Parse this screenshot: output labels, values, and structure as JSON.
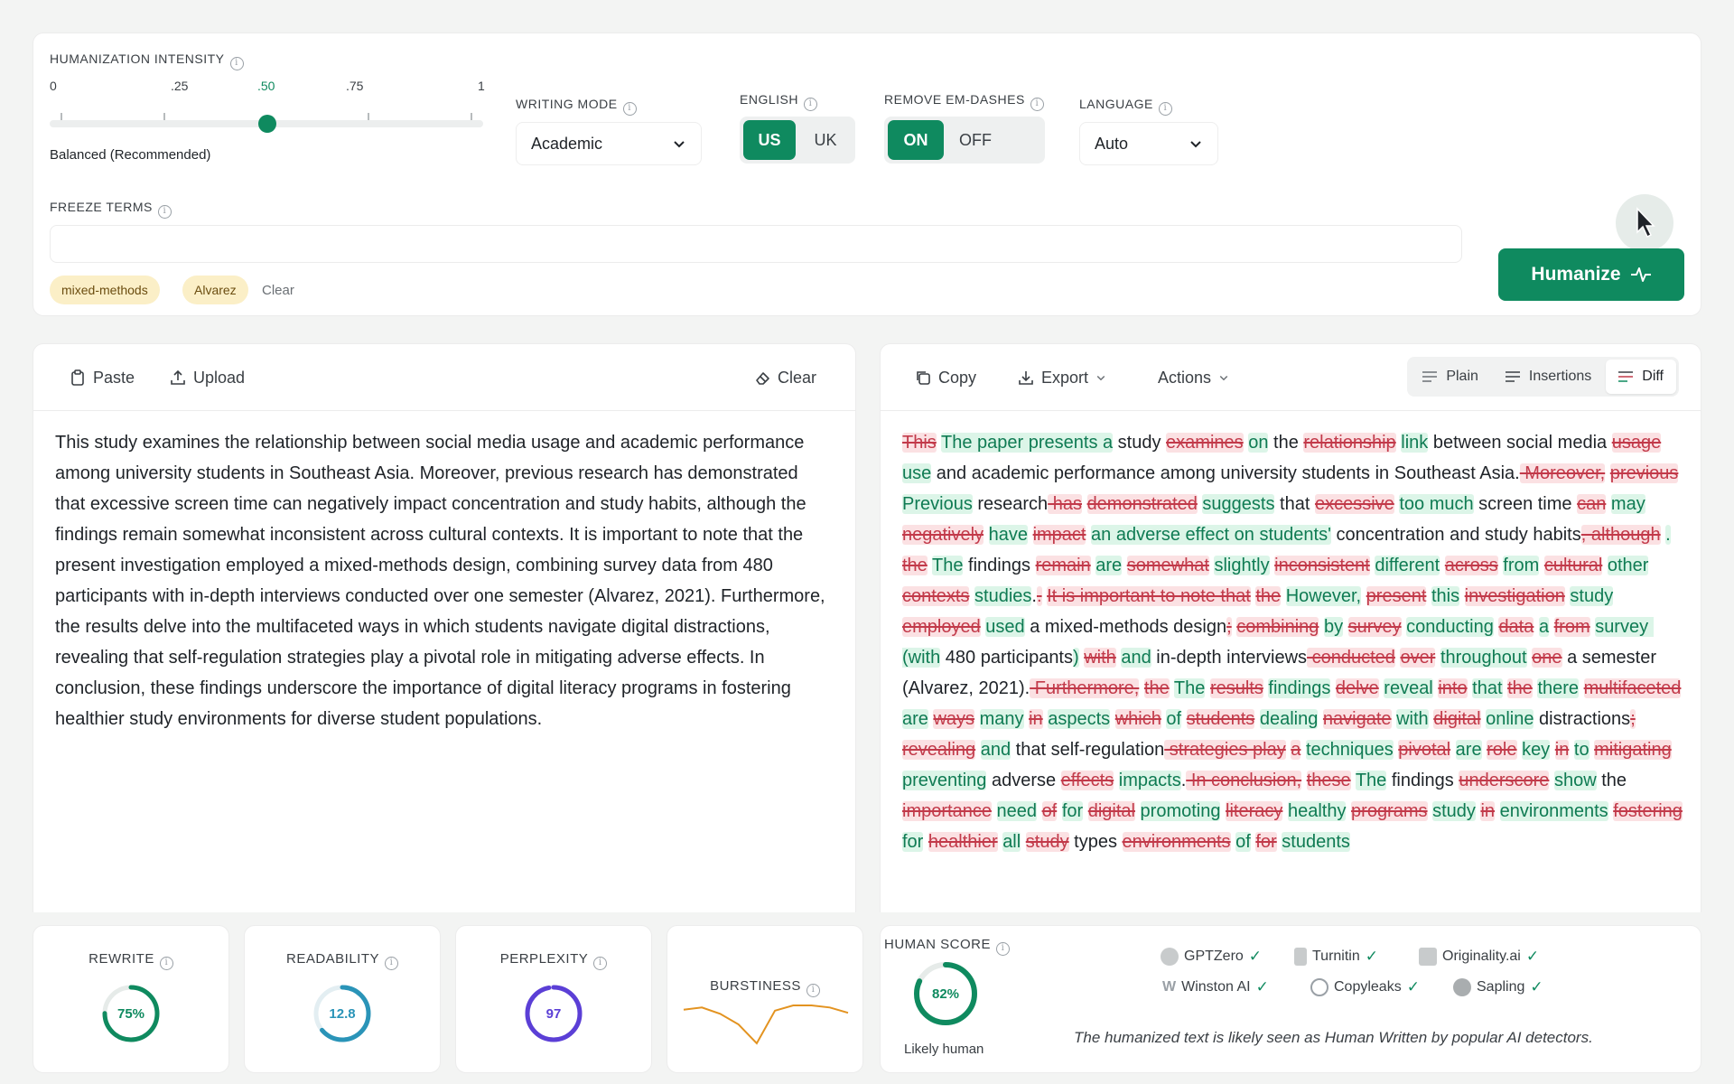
{
  "settings": {
    "intensity": {
      "label": "HUMANIZATION INTENSITY",
      "ticks": [
        "0",
        ".25",
        ".50",
        ".75",
        "1"
      ],
      "active_tick": ".50",
      "value": 0.5,
      "caption": "Balanced (Recommended)"
    },
    "writing_mode": {
      "label": "WRITING MODE",
      "value": "Academic"
    },
    "english": {
      "label": "ENGLISH",
      "options": [
        "US",
        "UK"
      ],
      "selected": "US"
    },
    "em_dashes": {
      "label": "REMOVE EM-DASHES",
      "options": [
        "ON",
        "OFF"
      ],
      "selected": "ON"
    },
    "language": {
      "label": "LANGUAGE",
      "value": "Auto"
    },
    "freeze_terms": {
      "label": "FREEZE TERMS",
      "value": "",
      "chips": [
        "mixed-methods",
        "Alvarez"
      ],
      "clear_label": "Clear"
    },
    "humanize_button": "Humanize"
  },
  "input_panel": {
    "paste_label": "Paste",
    "upload_label": "Upload",
    "clear_label": "Clear",
    "text": "This study examines the relationship between social media usage and academic performance among university students in Southeast Asia. Moreover, previous research has demonstrated that excessive screen time can negatively impact concentration and study habits, although the findings remain somewhat inconsistent across cultural contexts. It is important to note that the present investigation employed a mixed-methods design, combining survey data from 480 participants with in-depth interviews conducted over one semester (Alvarez, 2021). Furthermore, the results delve into the multifaceted ways in which students navigate digital distractions, revealing that self-regulation strategies play a pivotal role in mitigating adverse effects. In conclusion, these findings underscore the importance of digital literacy programs in fostering healthier study environments for diverse student populations."
  },
  "output_panel": {
    "copy_label": "Copy",
    "export_label": "Export",
    "actions_label": "Actions",
    "views": [
      "Plain",
      "Insertions",
      "Diff"
    ],
    "selected_view": "Diff",
    "diff": [
      [
        "d",
        "This"
      ],
      [
        " ",
        " "
      ],
      [
        "i",
        "The paper presents a"
      ],
      [
        " ",
        " study "
      ],
      [
        "d",
        "examines"
      ],
      [
        " ",
        " "
      ],
      [
        "i",
        "on"
      ],
      [
        " ",
        " the "
      ],
      [
        "d",
        "relationship"
      ],
      [
        " ",
        " "
      ],
      [
        "i",
        "link"
      ],
      [
        " ",
        " between social media "
      ],
      [
        "d",
        "usage"
      ],
      [
        " ",
        " "
      ],
      [
        "i",
        "use"
      ],
      [
        " ",
        " and academic performance among university students in Southeast Asia."
      ],
      [
        "d",
        " Moreover,"
      ],
      [
        " ",
        " "
      ],
      [
        "d",
        "previous"
      ],
      [
        " ",
        " "
      ],
      [
        "i",
        "Previous"
      ],
      [
        " ",
        " research"
      ],
      [
        "d",
        " has"
      ],
      [
        " ",
        " "
      ],
      [
        "d",
        "demonstrated"
      ],
      [
        " ",
        " "
      ],
      [
        "i",
        "suggests"
      ],
      [
        " ",
        " that "
      ],
      [
        "d",
        "excessive"
      ],
      [
        " ",
        " "
      ],
      [
        "i",
        "too much"
      ],
      [
        " ",
        " screen time "
      ],
      [
        "d",
        "can"
      ],
      [
        " ",
        " "
      ],
      [
        "i",
        "may"
      ],
      [
        " ",
        " "
      ],
      [
        "d",
        "negatively"
      ],
      [
        " ",
        " "
      ],
      [
        "i",
        "have"
      ],
      [
        " ",
        " "
      ],
      [
        "d",
        "impact"
      ],
      [
        " ",
        " "
      ],
      [
        "i",
        "an adverse effect on students'"
      ],
      [
        " ",
        " concentration and study habits"
      ],
      [
        "d",
        ", although"
      ],
      [
        " ",
        " "
      ],
      [
        "i",
        "."
      ],
      [
        " ",
        " "
      ],
      [
        "d",
        "the"
      ],
      [
        " ",
        " "
      ],
      [
        "i",
        "The"
      ],
      [
        " ",
        " findings "
      ],
      [
        "d",
        "remain"
      ],
      [
        " ",
        " "
      ],
      [
        "i",
        "are"
      ],
      [
        " ",
        " "
      ],
      [
        "d",
        "somewhat"
      ],
      [
        " ",
        " "
      ],
      [
        "i",
        "slightly"
      ],
      [
        " ",
        " "
      ],
      [
        "d",
        "inconsistent"
      ],
      [
        " ",
        " "
      ],
      [
        "i",
        "different"
      ],
      [
        " ",
        " "
      ],
      [
        "d",
        "across"
      ],
      [
        " ",
        " "
      ],
      [
        "i",
        "from"
      ],
      [
        " ",
        " "
      ],
      [
        "d",
        "cultural"
      ],
      [
        " ",
        " "
      ],
      [
        "i",
        "other"
      ],
      [
        " ",
        " "
      ],
      [
        "d",
        "contexts"
      ],
      [
        " ",
        " "
      ],
      [
        "i",
        "studies"
      ],
      [
        " ",
        "."
      ],
      [
        "d",
        "."
      ],
      [
        " ",
        " "
      ],
      [
        "d",
        "It is important to note that"
      ],
      [
        " ",
        " "
      ],
      [
        "d",
        "the"
      ],
      [
        " ",
        " "
      ],
      [
        "i",
        "However,"
      ],
      [
        " ",
        " "
      ],
      [
        "d",
        "present"
      ],
      [
        " ",
        " "
      ],
      [
        "i",
        "this"
      ],
      [
        " ",
        " "
      ],
      [
        "d",
        "investigation"
      ],
      [
        " ",
        " "
      ],
      [
        "i",
        "study"
      ],
      [
        " ",
        " "
      ],
      [
        "d",
        "employed"
      ],
      [
        " ",
        " "
      ],
      [
        "i",
        "used"
      ],
      [
        " ",
        " a mixed-methods design"
      ],
      [
        "d",
        ";"
      ],
      [
        " ",
        " "
      ],
      [
        "d",
        "combining"
      ],
      [
        " ",
        " "
      ],
      [
        "i",
        "by"
      ],
      [
        " ",
        " "
      ],
      [
        "d",
        "survey"
      ],
      [
        " ",
        " "
      ],
      [
        "i",
        "conducting"
      ],
      [
        " ",
        " "
      ],
      [
        "d",
        "data"
      ],
      [
        " ",
        " "
      ],
      [
        "i",
        "a"
      ],
      [
        " ",
        " "
      ],
      [
        "d",
        "from"
      ],
      [
        " ",
        " "
      ],
      [
        "i",
        "survey (with"
      ],
      [
        " ",
        " 480 participants"
      ],
      [
        "i",
        ")"
      ],
      [
        " ",
        " "
      ],
      [
        "d",
        "with"
      ],
      [
        " ",
        " "
      ],
      [
        "i",
        "and"
      ],
      [
        " ",
        " in-depth interviews"
      ],
      [
        "d",
        " conducted"
      ],
      [
        " ",
        " "
      ],
      [
        "d",
        "over"
      ],
      [
        " ",
        " "
      ],
      [
        "i",
        "throughout"
      ],
      [
        " ",
        " "
      ],
      [
        "d",
        "one"
      ],
      [
        " ",
        " a semester (Alvarez, 2021)."
      ],
      [
        "d",
        " Furthermore,"
      ],
      [
        " ",
        " "
      ],
      [
        "d",
        "the"
      ],
      [
        " ",
        " "
      ],
      [
        "i",
        "The"
      ],
      [
        " ",
        " "
      ],
      [
        "d",
        "results"
      ],
      [
        " ",
        " "
      ],
      [
        "i",
        "findings"
      ],
      [
        " ",
        " "
      ],
      [
        "d",
        "delve"
      ],
      [
        " ",
        " "
      ],
      [
        "i",
        "reveal"
      ],
      [
        " ",
        " "
      ],
      [
        "d",
        "into"
      ],
      [
        " ",
        " "
      ],
      [
        "i",
        "that"
      ],
      [
        " ",
        " "
      ],
      [
        "d",
        "the"
      ],
      [
        " ",
        " "
      ],
      [
        "i",
        "there"
      ],
      [
        " ",
        " "
      ],
      [
        "d",
        "multifaceted"
      ],
      [
        " ",
        " "
      ],
      [
        "i",
        "are"
      ],
      [
        " ",
        " "
      ],
      [
        "d",
        "ways"
      ],
      [
        " ",
        " "
      ],
      [
        "i",
        "many"
      ],
      [
        " ",
        " "
      ],
      [
        "d",
        "in"
      ],
      [
        " ",
        " "
      ],
      [
        "i",
        "aspects"
      ],
      [
        " ",
        " "
      ],
      [
        "d",
        "which"
      ],
      [
        " ",
        " "
      ],
      [
        "i",
        "of"
      ],
      [
        " ",
        " "
      ],
      [
        "d",
        "students"
      ],
      [
        " ",
        " "
      ],
      [
        "i",
        "dealing"
      ],
      [
        " ",
        " "
      ],
      [
        "d",
        "navigate"
      ],
      [
        " ",
        " "
      ],
      [
        "i",
        "with"
      ],
      [
        " ",
        " "
      ],
      [
        "d",
        "digital"
      ],
      [
        " ",
        " "
      ],
      [
        "i",
        "online"
      ],
      [
        " ",
        " distractions"
      ],
      [
        "d",
        ";"
      ],
      [
        " ",
        " "
      ],
      [
        "d",
        "revealing"
      ],
      [
        " ",
        " "
      ],
      [
        "i",
        "and"
      ],
      [
        " ",
        " that self-regulation"
      ],
      [
        "d",
        " strategies play"
      ],
      [
        " ",
        " "
      ],
      [
        "d",
        "a"
      ],
      [
        " ",
        " "
      ],
      [
        "i",
        "techniques"
      ],
      [
        " ",
        " "
      ],
      [
        "d",
        "pivotal"
      ],
      [
        " ",
        " "
      ],
      [
        "i",
        "are"
      ],
      [
        " ",
        " "
      ],
      [
        "d",
        "role"
      ],
      [
        " ",
        " "
      ],
      [
        "i",
        "key"
      ],
      [
        " ",
        " "
      ],
      [
        "d",
        "in"
      ],
      [
        " ",
        " "
      ],
      [
        "i",
        "to"
      ],
      [
        " ",
        " "
      ],
      [
        "d",
        "mitigating"
      ],
      [
        " ",
        " "
      ],
      [
        "i",
        "preventing"
      ],
      [
        " ",
        " adverse "
      ],
      [
        "d",
        "effects"
      ],
      [
        " ",
        " "
      ],
      [
        "i",
        "impacts"
      ],
      [
        " ",
        "."
      ],
      [
        "d",
        " In conclusion,"
      ],
      [
        " ",
        " "
      ],
      [
        "d",
        "these"
      ],
      [
        " ",
        " "
      ],
      [
        "i",
        "The"
      ],
      [
        " ",
        " findings "
      ],
      [
        "d",
        "underscore"
      ],
      [
        " ",
        " "
      ],
      [
        "i",
        "show"
      ],
      [
        " ",
        " the "
      ],
      [
        "d",
        "importance"
      ],
      [
        " ",
        " "
      ],
      [
        "i",
        "need"
      ],
      [
        " ",
        " "
      ],
      [
        "d",
        "of"
      ],
      [
        " ",
        " "
      ],
      [
        "i",
        "for"
      ],
      [
        " ",
        " "
      ],
      [
        "d",
        "digital"
      ],
      [
        " ",
        " "
      ],
      [
        "i",
        "promoting"
      ],
      [
        " ",
        " "
      ],
      [
        "d",
        "literacy"
      ],
      [
        " ",
        " "
      ],
      [
        "i",
        "healthy"
      ],
      [
        " ",
        " "
      ],
      [
        "d",
        "programs"
      ],
      [
        " ",
        " "
      ],
      [
        "i",
        "study"
      ],
      [
        " ",
        " "
      ],
      [
        "d",
        "in"
      ],
      [
        " ",
        " "
      ],
      [
        "i",
        "environments"
      ],
      [
        " ",
        " "
      ],
      [
        "d",
        "fostering"
      ],
      [
        " ",
        " "
      ],
      [
        "i",
        "for"
      ],
      [
        " ",
        " "
      ],
      [
        "d",
        "healthier"
      ],
      [
        " ",
        " "
      ],
      [
        "i",
        "all"
      ],
      [
        " ",
        " "
      ],
      [
        "d",
        "study"
      ],
      [
        " ",
        " types "
      ],
      [
        "d",
        "environments"
      ],
      [
        " ",
        " "
      ],
      [
        "i",
        "of"
      ],
      [
        " ",
        " "
      ],
      [
        "d",
        "for"
      ],
      [
        " ",
        " "
      ],
      [
        "i",
        "students"
      ]
    ]
  },
  "metrics": {
    "rewrite": {
      "label": "REWRITE",
      "value": "75%",
      "fraction": 0.75,
      "color": "#0f8a5f"
    },
    "readability": {
      "label": "READABILITY",
      "value": "12.8",
      "fraction": 0.64,
      "color": "#2a94b8"
    },
    "perplexity": {
      "label": "PERPLEXITY",
      "value": "97",
      "fraction": 0.97,
      "color": "#5b3fd6"
    },
    "burstiness": {
      "label": "BURSTINESS",
      "series": [
        6,
        6.2,
        5.6,
        4.6,
        2.8,
        5.9,
        6.4,
        6.4,
        6.2,
        5.7
      ],
      "color": "#e39320"
    }
  },
  "human_score": {
    "label": "HUMAN SCORE",
    "value": "82%",
    "fraction": 0.82,
    "caption": "Likely human",
    "detectors": [
      "GPTZero",
      "Turnitin",
      "Originality.ai",
      "Winston AI",
      "Copyleaks",
      "Sapling"
    ],
    "note": "The humanized text is likely seen as Human Written by popular AI detectors."
  },
  "colors": {
    "accent": "#0f8a5f",
    "deleted": "#c23a4a",
    "inserted": "#0f7b53"
  }
}
